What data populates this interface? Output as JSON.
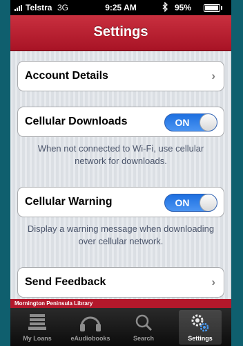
{
  "status_bar": {
    "carrier": "Telstra",
    "network": "3G",
    "time": "9:25 AM",
    "battery": "95%"
  },
  "nav": {
    "title": "Settings"
  },
  "settings": {
    "account": {
      "label": "Account Details"
    },
    "cellular_downloads": {
      "label": "Cellular Downloads",
      "toggle": "ON",
      "description": "When not connected to Wi-Fi, use cellular network for downloads."
    },
    "cellular_warning": {
      "label": "Cellular Warning",
      "toggle": "ON",
      "description": "Display a warning message when downloading over cellular network."
    },
    "feedback": {
      "label": "Send Feedback"
    }
  },
  "library_name": "Mornington Peninsula Library",
  "tabs": [
    {
      "label": "My Loans",
      "icon": "stack-icon",
      "active": false
    },
    {
      "label": "eAudiobooks",
      "icon": "headphones-icon",
      "active": false
    },
    {
      "label": "Search",
      "icon": "magnifier-icon",
      "active": false
    },
    {
      "label": "Settings",
      "icon": "gears-icon",
      "active": true
    }
  ],
  "colors": {
    "nav_red": "#b91c2e",
    "toggle_blue": "#2a7ce8",
    "background": "#dfe3e8",
    "tab_bar": "#1a1a1a"
  }
}
